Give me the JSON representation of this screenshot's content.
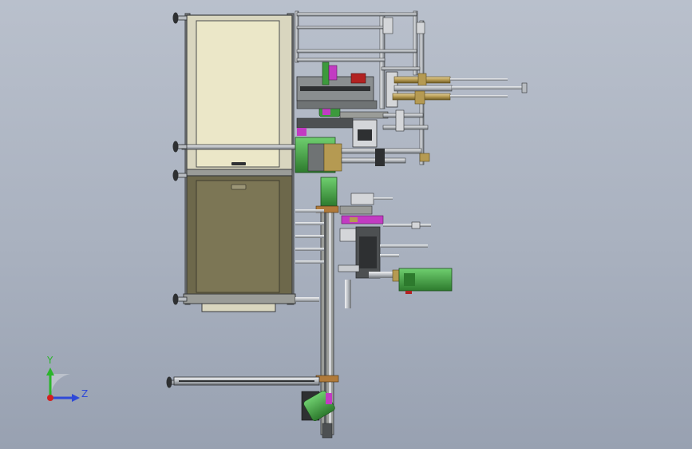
{
  "viewport": {
    "background_top": "#b9c0cc",
    "background_bottom": "#98a1b1"
  },
  "triad": {
    "y_label": "Y",
    "z_label": "Z",
    "y_color": "#2bb52b",
    "z_color": "#2f49d8",
    "x_color": "#d42020"
  },
  "colors": {
    "frame": "#6f7374",
    "upper_panel": "#ebe7c8",
    "lower_panel": "#7c7655",
    "green": "#3c9a3c",
    "magenta": "#c23bc2",
    "brass": "#b59a52",
    "steel": "#c9ccd0",
    "dark": "#2e3032"
  }
}
